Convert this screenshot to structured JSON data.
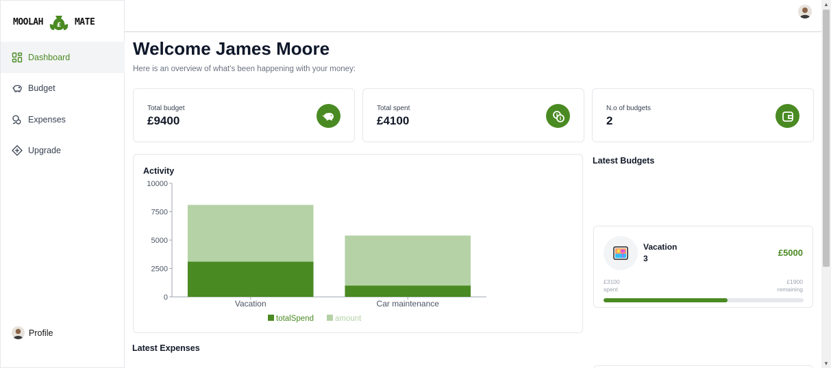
{
  "app": {
    "logo_left": "MOOLAH",
    "logo_right": "MATE"
  },
  "sidebar": {
    "items": [
      {
        "label": "Dashboard",
        "icon": "dashboard-grid-icon",
        "active": true
      },
      {
        "label": "Budget",
        "icon": "piggy-bank-icon",
        "active": false
      },
      {
        "label": "Expenses",
        "icon": "coins-icon",
        "active": false
      },
      {
        "label": "Upgrade",
        "icon": "shield-plus-icon",
        "active": false
      }
    ],
    "profile_label": "Profile"
  },
  "header": {
    "welcome": "Welcome James Moore",
    "subtitle": "Here is an overview of what's been happening with your money:"
  },
  "stats": [
    {
      "label": "Total budget",
      "value": "£9400",
      "icon": "piggy-bank-icon"
    },
    {
      "label": "Total spent",
      "value": "£4100",
      "icon": "coins-icon"
    },
    {
      "label": "N.o of budgets",
      "value": "2",
      "icon": "wallet-icon"
    }
  ],
  "colors": {
    "accent": "#4a8a22",
    "accent_light": "#b5d2a6",
    "active_bg": "#f3f4f6"
  },
  "chart_data": {
    "type": "bar",
    "stacked": true,
    "title": "Activity",
    "categories": [
      "Vacation",
      "Car maintenance"
    ],
    "series": [
      {
        "name": "totalSpend",
        "values": [
          3100,
          1000
        ],
        "color": "#4a8a22"
      },
      {
        "name": "amount",
        "values": [
          5000,
          4400
        ],
        "color": "#b5d2a6"
      }
    ],
    "y_ticks": [
      "0",
      "2500",
      "5000",
      "7500",
      "10000"
    ],
    "ylim": [
      0,
      10000
    ],
    "legend_position": "bottom"
  },
  "latest_budgets": {
    "title": "Latest Budgets",
    "items": [
      {
        "name": "Vacation",
        "count": "3",
        "amount": "£5000",
        "spent": "£3100",
        "spent_label": "spent",
        "remaining": "£1900",
        "remaining_label": "remaining",
        "progress": 0.62,
        "emoji": "beach-picture-icon"
      }
    ]
  },
  "latest_expenses": {
    "title": "Latest Expenses"
  }
}
